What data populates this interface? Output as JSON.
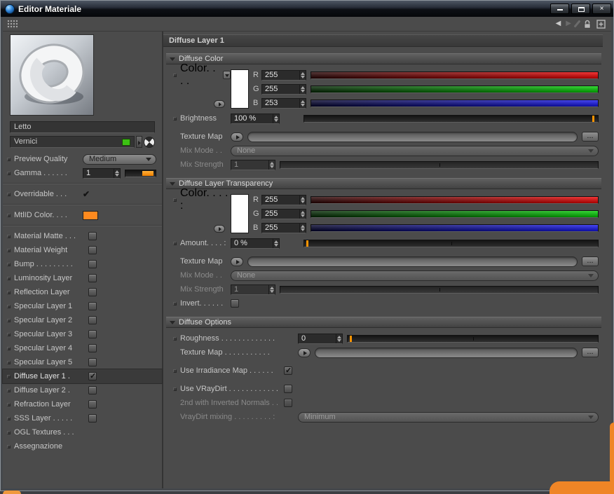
{
  "window": {
    "title": "Editor Materiale",
    "close_glyph": "×"
  },
  "toolbar": {
    "back_glyph": "◀",
    "forward_glyph": "▶"
  },
  "sidebar": {
    "name_value": "Letto",
    "material_value": "Vernici",
    "material_swatch_color": "#3cc213",
    "preview_quality_label": "Preview Quality",
    "preview_quality_value": "Medium",
    "gamma_label": "Gamma . . . . . .",
    "gamma_value": "1",
    "overridable_label": "Overridable . . .",
    "overridable_checked": true,
    "overridable_check_glyph": "✔",
    "mtlid_label": "MtlID Color. . . .",
    "mtlid_color": "#ff8a1e",
    "channels": [
      {
        "label": "Material Matte . . .",
        "checked": false,
        "selected": false
      },
      {
        "label": "Material Weight",
        "checked": false,
        "selected": false
      },
      {
        "label": "Bump . . . . . . . . .",
        "checked": false,
        "selected": false
      },
      {
        "label": "Luminosity Layer",
        "checked": false,
        "selected": false
      },
      {
        "label": "Reflection Layer",
        "checked": false,
        "selected": false
      },
      {
        "label": "Specular Layer 1",
        "checked": false,
        "selected": false
      },
      {
        "label": "Specular Layer 2",
        "checked": false,
        "selected": false
      },
      {
        "label": "Specular Layer 3",
        "checked": false,
        "selected": false
      },
      {
        "label": "Specular Layer 4",
        "checked": false,
        "selected": false
      },
      {
        "label": "Specular Layer 5",
        "checked": false,
        "selected": false
      },
      {
        "label": "Diffuse Layer 1 .",
        "checked": true,
        "selected": true
      },
      {
        "label": "Diffuse Layer 2 .",
        "checked": false,
        "selected": false
      },
      {
        "label": "Refraction Layer",
        "checked": false,
        "selected": false
      },
      {
        "label": "SSS Layer . . . . .",
        "checked": false,
        "selected": false
      },
      {
        "label": "OGL Textures . . .",
        "no_checkbox": true
      },
      {
        "label": "Assegnazione",
        "no_checkbox": true
      }
    ]
  },
  "main": {
    "title": "Diffuse Layer 1",
    "more_label": "...",
    "accent_color": "#ff9400",
    "diffuse_color": {
      "header": "Diffuse Color",
      "color_label": "Color. . . .",
      "swatch": "#ffffff",
      "r_label": "R",
      "r_value": "255",
      "g_label": "G",
      "g_value": "255",
      "b_label": "B",
      "b_value": "253",
      "brightness_label": "Brightness",
      "brightness_value": "100 %",
      "texture_map_label": "Texture Map",
      "mix_mode_label": "Mix Mode . .",
      "mix_mode_value": "None",
      "mix_strength_label": "Mix Strength",
      "mix_strength_value": "1"
    },
    "transparency": {
      "header": "Diffuse Layer Transparency",
      "color_label": "Color. . . . :",
      "swatch": "#ffffff",
      "r_label": "R",
      "r_value": "255",
      "g_label": "G",
      "g_value": "255",
      "b_label": "B",
      "b_value": "255",
      "amount_label": "Amount. . . . :",
      "amount_value": "0 %",
      "texture_map_label": "Texture Map",
      "mix_mode_label": "Mix Mode . .",
      "mix_mode_value": "None",
      "mix_strength_label": "Mix Strength",
      "mix_strength_value": "1",
      "invert_label": "Invert. . . . . .",
      "invert_checked": false
    },
    "options": {
      "header": "Diffuse Options",
      "roughness_label": "Roughness . . . . . . . . . . . . .",
      "roughness_value": "0",
      "texture_map_label": "Texture Map . . . . . . . . . . .",
      "use_irradiance_label": "Use Irradiance Map . . . . . .",
      "use_irradiance_checked": true,
      "use_vraydirt_label": "Use VRayDirt . . . . . . . . . . . .",
      "use_vraydirt_checked": false,
      "inverted_normals_label": "2nd with Inverted Normals . .",
      "vraydirt_mixing_label": "VrayDirt mixing . . . . . . . . . :",
      "vraydirt_mixing_value": "Minimum"
    }
  }
}
